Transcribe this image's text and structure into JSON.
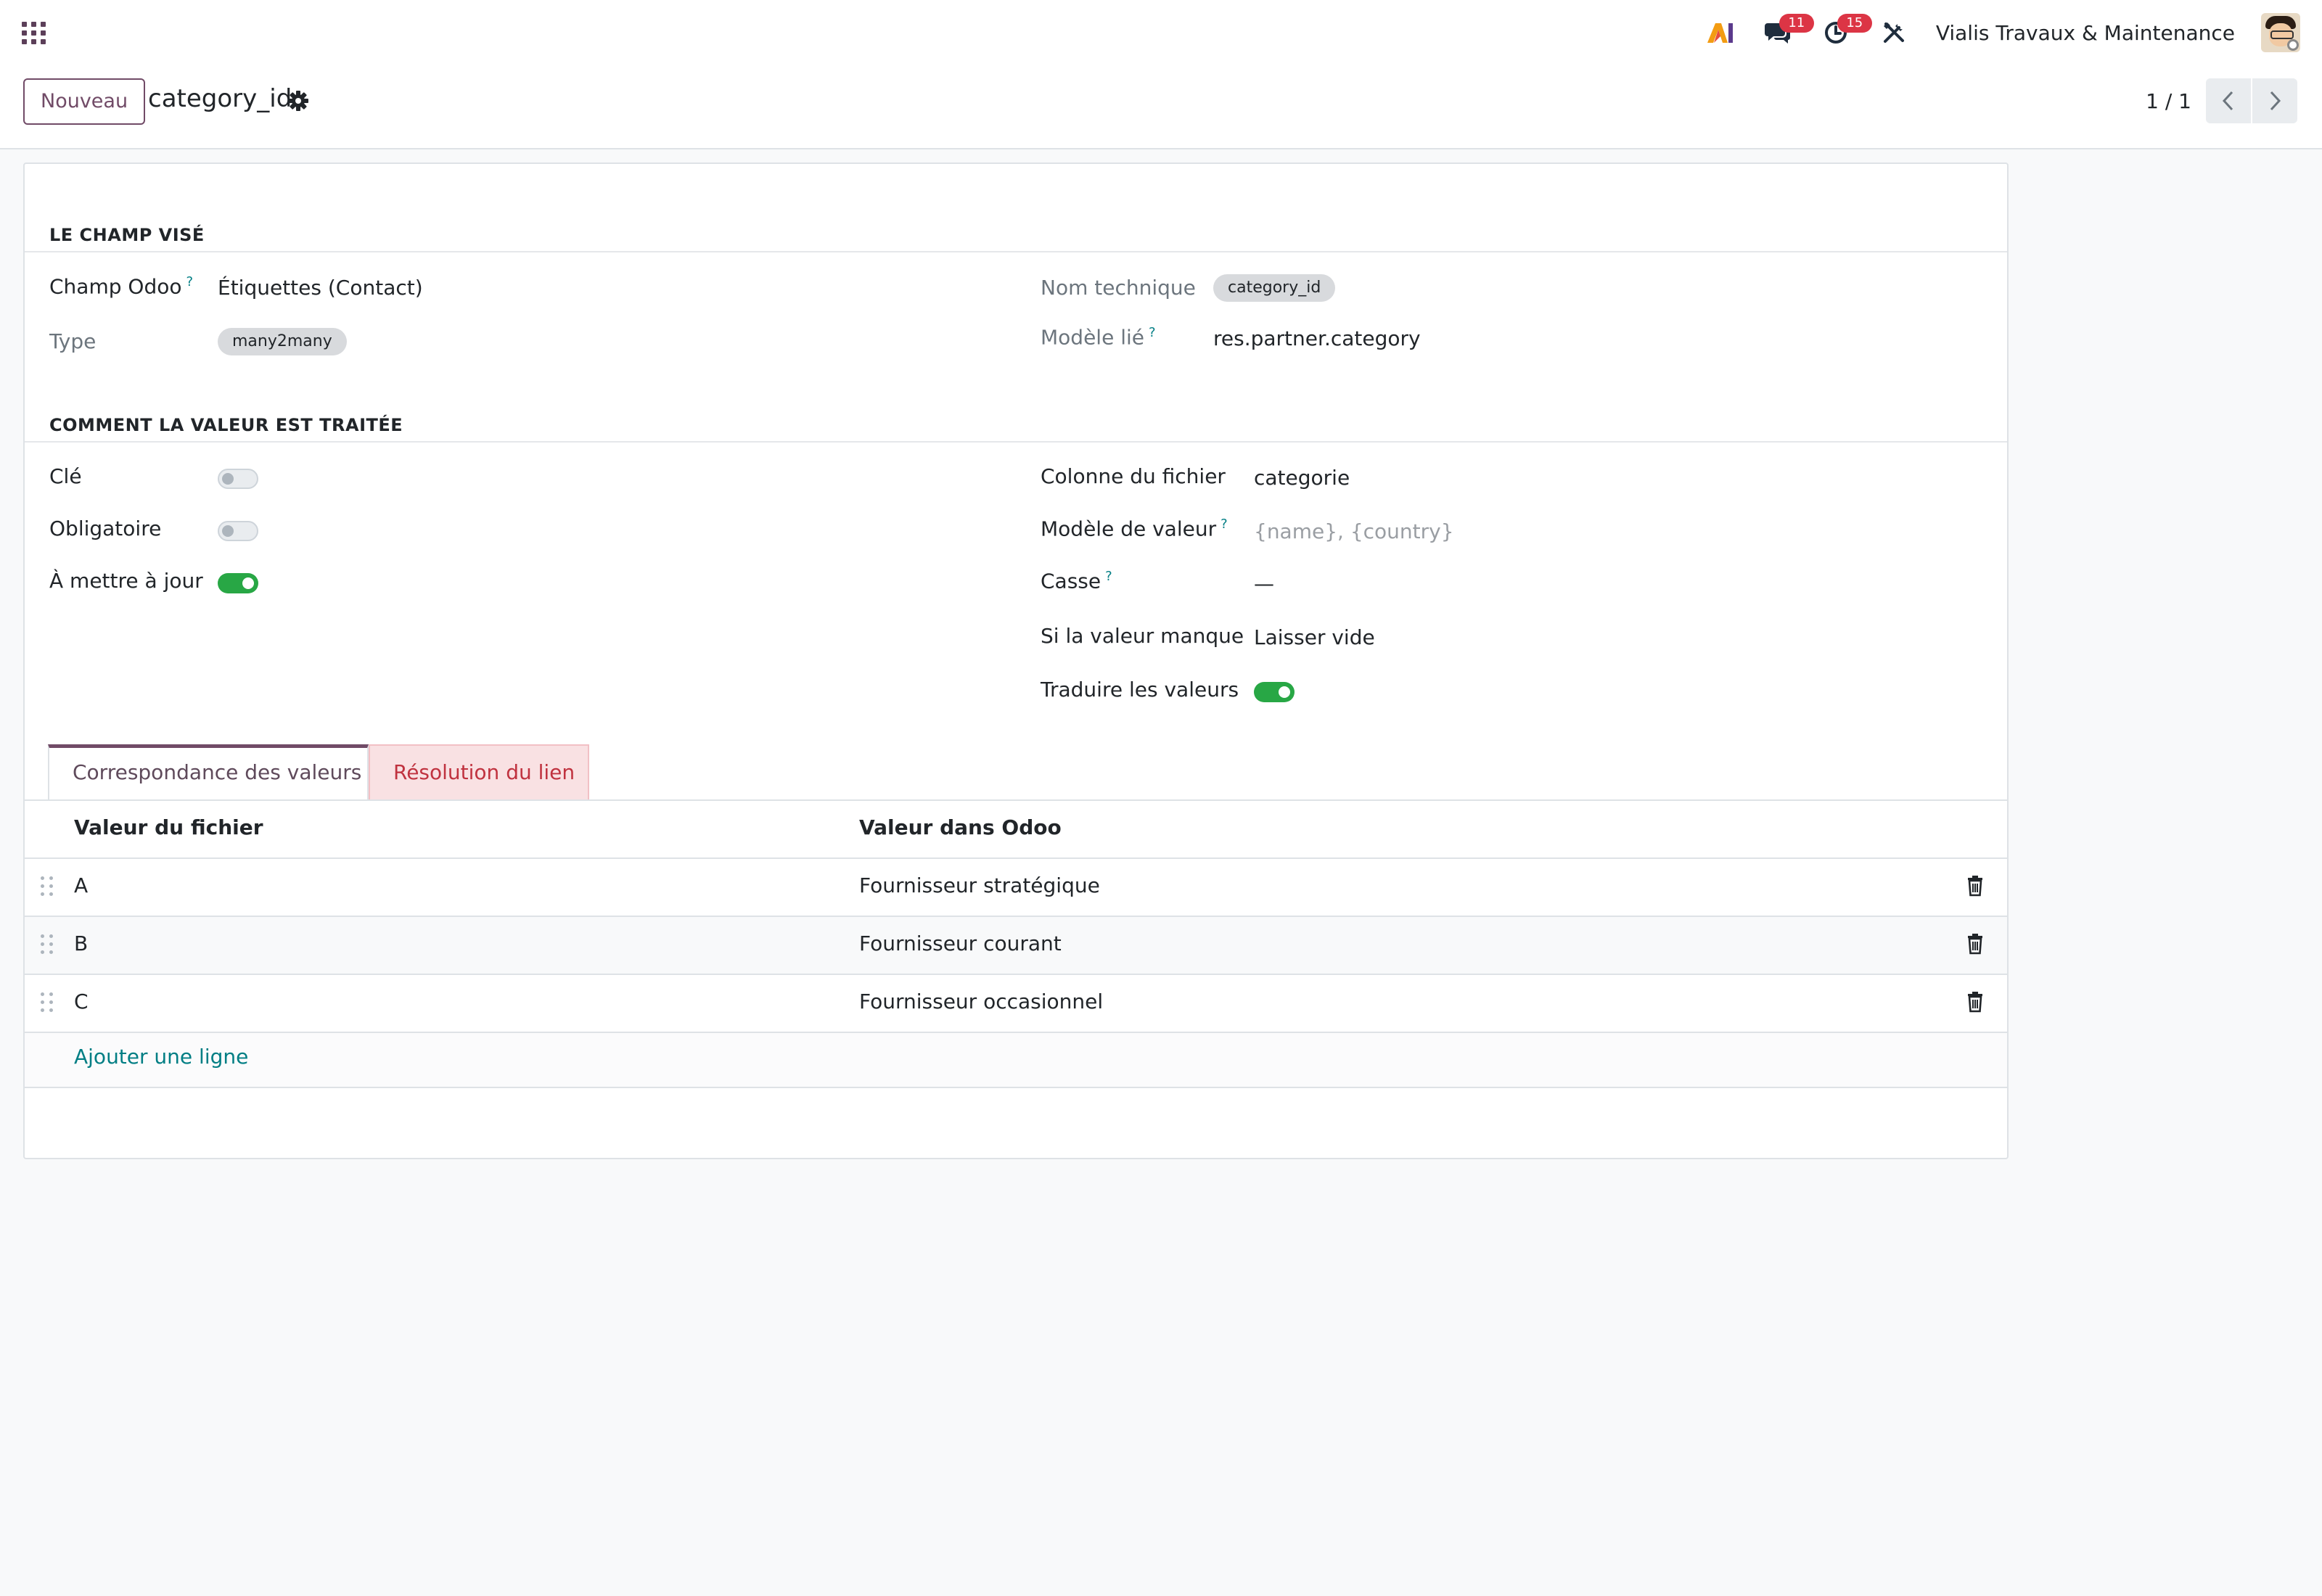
{
  "navbar": {
    "ai_label": "AI",
    "messages_count": "11",
    "activities_count": "15",
    "company": "Vialis Travaux & Maintenance"
  },
  "control": {
    "new_button": "Nouveau",
    "record_title": "category_id",
    "pager_value": "1 / 1"
  },
  "section_target": {
    "title": "LE CHAMP VISÉ",
    "odoo_field_label": "Champ Odoo",
    "odoo_field_value": "Étiquettes (Contact)",
    "technical_name_label": "Nom technique",
    "technical_name_value": "category_id",
    "type_label": "Type",
    "type_value": "many2many",
    "related_model_label": "Modèle lié",
    "related_model_value": "res.partner.category",
    "help_mark": "?"
  },
  "section_processing": {
    "title": "COMMENT LA VALEUR EST TRAITÉE",
    "key_label": "Clé",
    "key_value": false,
    "required_label": "Obligatoire",
    "required_value": false,
    "update_label": "À mettre à jour",
    "update_value": true,
    "file_column_label": "Colonne du fichier",
    "file_column_value": "categorie",
    "value_template_label": "Modèle de valeur",
    "value_template_placeholder": "{name}, {country}",
    "case_label": "Casse",
    "case_value": "—",
    "missing_label": "Si la valeur manque",
    "missing_value": "Laisser vide",
    "translate_label": "Traduire les valeurs",
    "translate_value": true
  },
  "tabs": {
    "mapping": "Correspondance des valeurs",
    "link_resolution": "Résolution du lien"
  },
  "table": {
    "col_file_value": "Valeur du fichier",
    "col_odoo_value": "Valeur dans Odoo",
    "rows": [
      {
        "file": "A",
        "odoo": "Fournisseur stratégique"
      },
      {
        "file": "B",
        "odoo": "Fournisseur courant"
      },
      {
        "file": "C",
        "odoo": "Fournisseur occasionnel"
      }
    ],
    "add_line": "Ajouter une ligne"
  },
  "colors": {
    "brand": "#714b67",
    "link": "#017e84",
    "toggle_on": "#28a745",
    "badge": "#dc3545"
  }
}
